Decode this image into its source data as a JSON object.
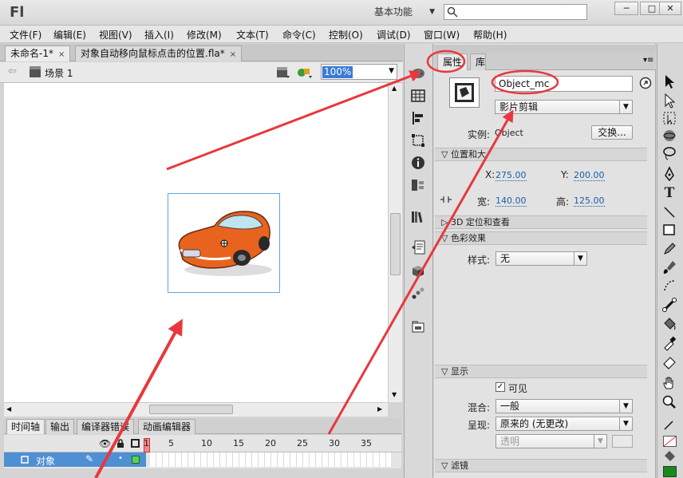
{
  "app": {
    "logo": "Fl",
    "workspace": "基本功能",
    "search_placeholder": "",
    "window_buttons": [
      "─",
      "□",
      "✕"
    ]
  },
  "menu": [
    "文件(F)",
    "编辑(E)",
    "视图(V)",
    "插入(I)",
    "修改(M)",
    "文本(T)",
    "命令(C)",
    "控制(O)",
    "调试(D)",
    "窗口(W)",
    "帮助(H)"
  ],
  "doc_tabs": [
    {
      "label": "未命名-1*",
      "close": "×"
    },
    {
      "label": "对象自动移向鼠标点击的位置.fla*",
      "close": "×"
    }
  ],
  "stage": {
    "scene_label": "场景 1",
    "zoom": "100%"
  },
  "timeline": {
    "tabs": [
      "时间轴",
      "输出",
      "编译器错误",
      "动画编辑器"
    ],
    "frame_numbers": [
      "1",
      "5",
      "10",
      "15",
      "20",
      "25",
      "30",
      "35"
    ],
    "layer_name": "对象"
  },
  "properties": {
    "tabs": [
      "属性",
      "库"
    ],
    "instance_name": "Object_mc",
    "symbol_type": "影片剪辑",
    "instance_label": "实例:",
    "instance_value": "Object",
    "swap_button": "交换...",
    "sections": {
      "position": "位置和大小",
      "position_visible": "位置和大",
      "3d": "3D 定位和查看",
      "color": "色彩效果",
      "display": "显示",
      "filters": "滤镜"
    },
    "x_label": "X:",
    "x_value": "275.00",
    "y_label": "Y:",
    "y_value": "200.00",
    "w_label": "宽:",
    "w_value": "140.00",
    "h_label": "高:",
    "h_value": "125.00",
    "style_label": "样式:",
    "style_value": "无",
    "visible_label": "可见",
    "blend_label": "混合:",
    "blend_value": "一般",
    "render_label": "呈现:",
    "render_value": "原来的 (无更改)",
    "transparent_value": "透明"
  },
  "colors": {
    "accent": "#3a7bd5",
    "annotation": "#e8383d",
    "layer_row": "#4f8fd3"
  }
}
